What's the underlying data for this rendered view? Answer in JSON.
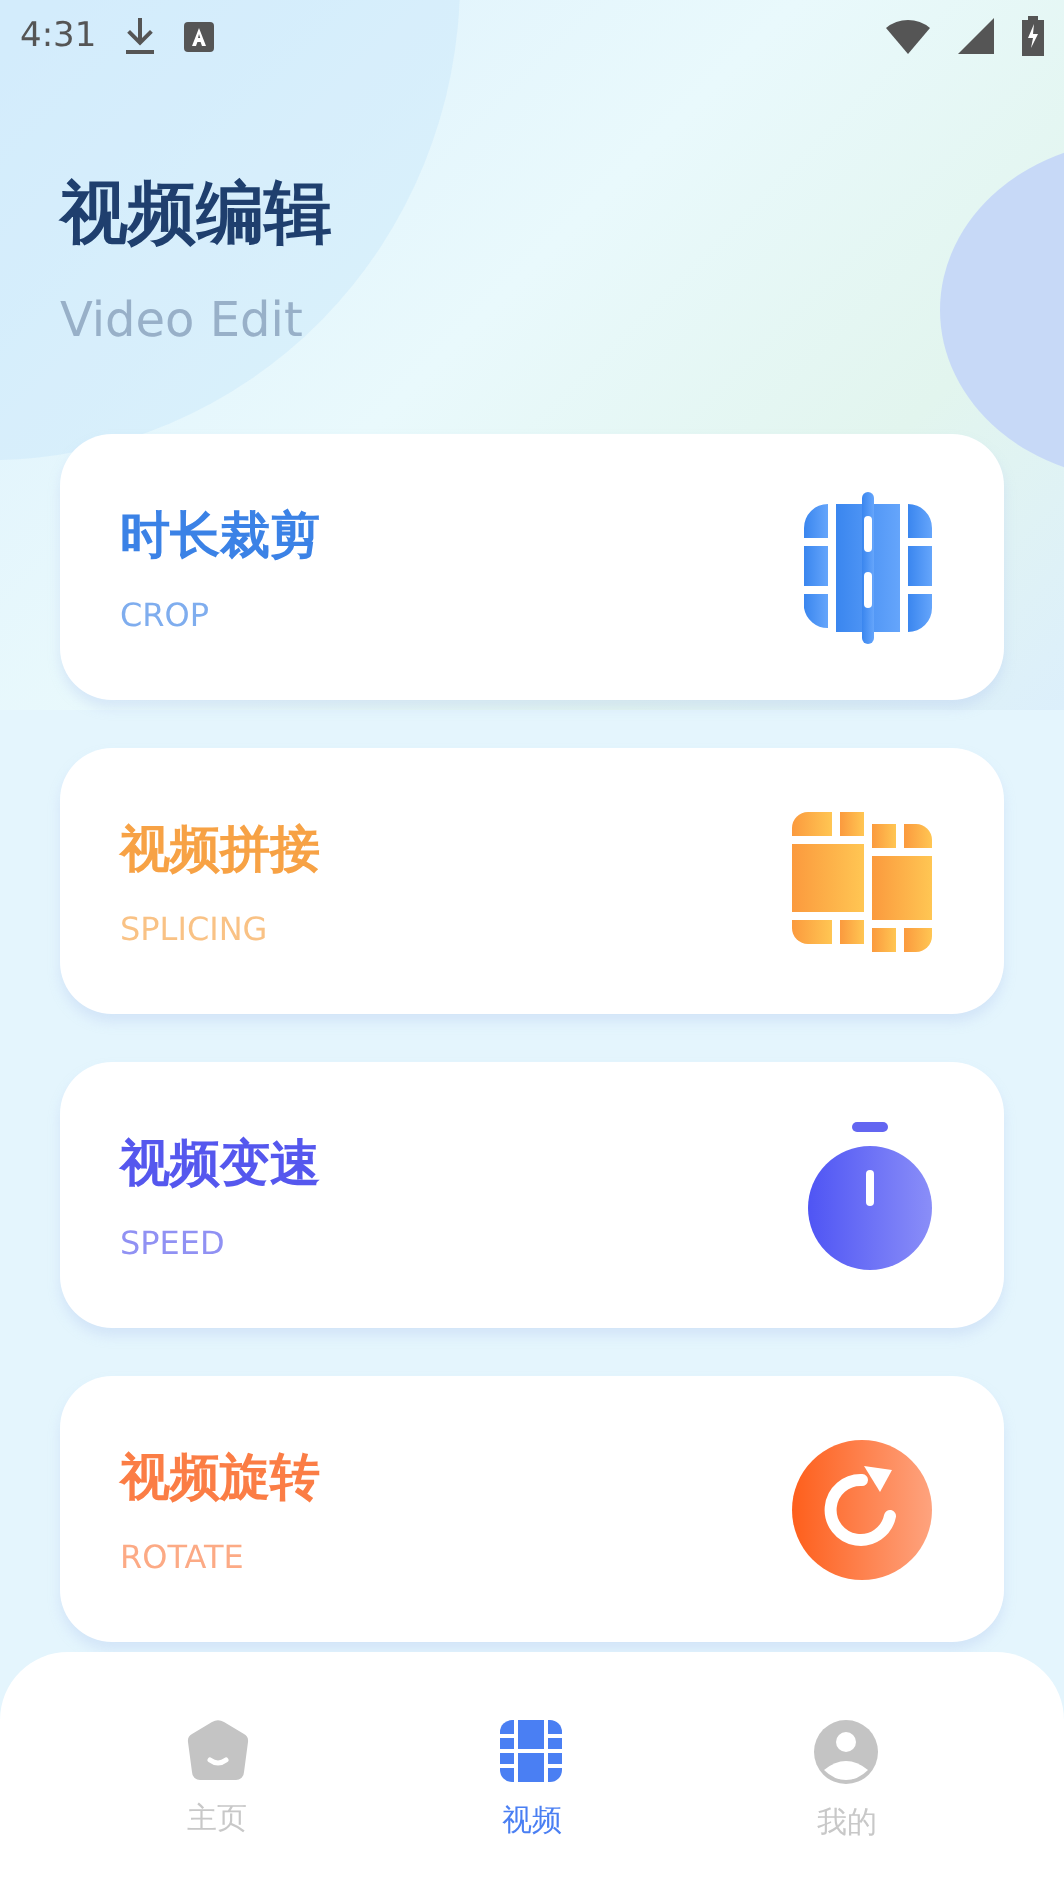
{
  "status_bar": {
    "time": "4:31"
  },
  "header": {
    "title": "视频编辑",
    "subtitle": "Video Edit"
  },
  "cards": [
    {
      "kind": "crop",
      "title": "时长裁剪",
      "subtitle": "CROP",
      "color": "#3b82e6"
    },
    {
      "kind": "splicing",
      "title": "视频拼接",
      "subtitle": "SPLICING",
      "color": "#f7a245"
    },
    {
      "kind": "speed",
      "title": "视频变速",
      "subtitle": "SPEED",
      "color": "#5557ee"
    },
    {
      "kind": "rotate",
      "title": "视频旋转",
      "subtitle": "ROTATE",
      "color": "#fb7d45"
    }
  ],
  "nav": [
    {
      "kind": "home",
      "label": "主页",
      "selected": false
    },
    {
      "kind": "video",
      "label": "视频",
      "selected": true
    },
    {
      "kind": "profile",
      "label": "我的",
      "selected": false
    }
  ]
}
